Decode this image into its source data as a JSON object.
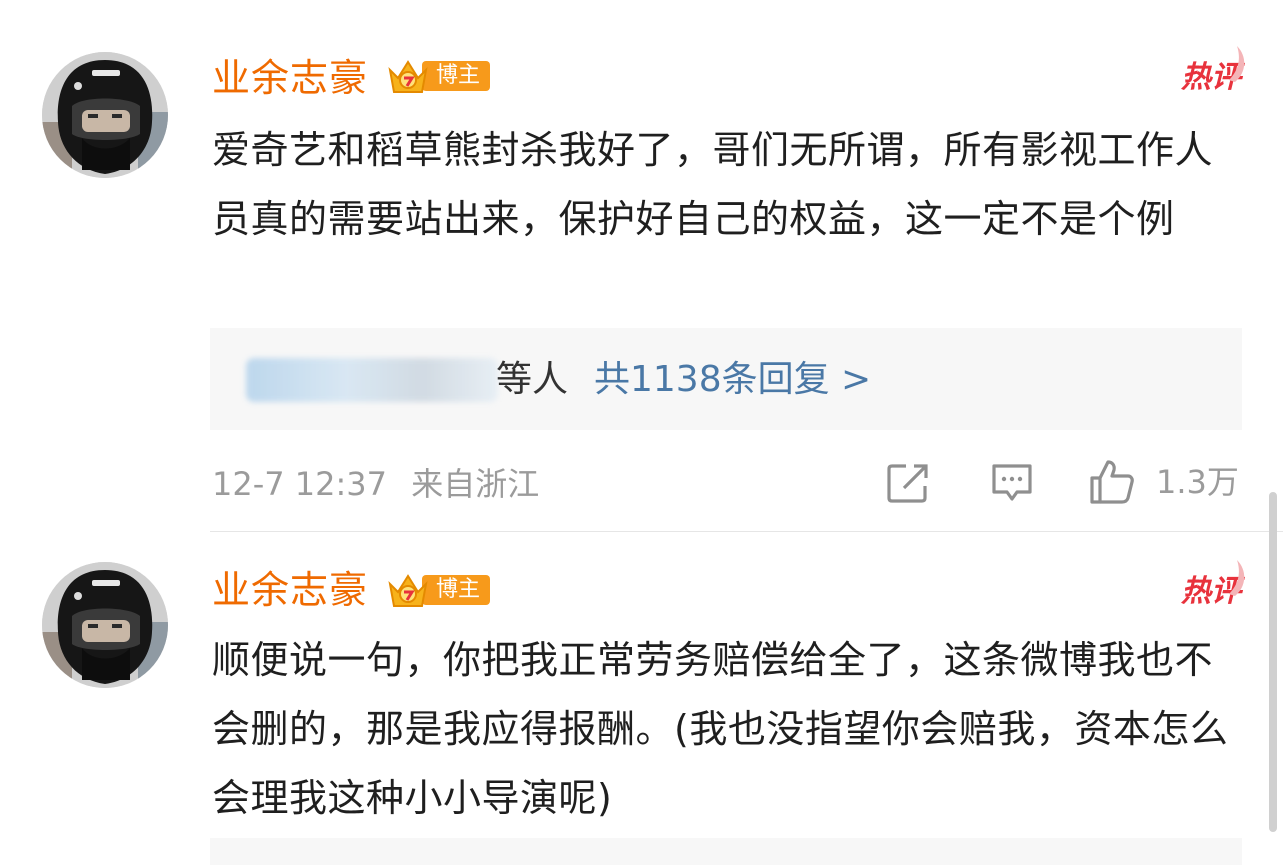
{
  "comments": [
    {
      "username": "业余志豪",
      "badge": "博主",
      "hot_label": "热评",
      "text": "爱奇艺和稻草熊封杀我好了，哥们无所谓，所有影视工作人员真的需要站出来，保护好自己的权益，这一定不是个例",
      "reply_others": "等人",
      "reply_link": "共1138条回复 >",
      "timestamp": "12-7 12:37",
      "location": "来自浙江",
      "like_count": "1.3万"
    },
    {
      "username": "业余志豪",
      "badge": "博主",
      "hot_label": "热评",
      "text": "顺便说一句，你把我正常劳务赔偿给全了，这条微博我也不会删的，那是我应得报酬。(我也没指望你会赔我，资本怎么会理我这种小小导演呢)"
    }
  ],
  "icons": {
    "share": "share-icon",
    "comment": "comment-icon",
    "like": "thumbs-up-icon",
    "crown": "crown-icon",
    "hot": "hot-comment-icon"
  },
  "colors": {
    "username": "#ef6a00",
    "badge": "#f79a1b",
    "hot": "#e8323c",
    "reply_link": "#4a78a6",
    "meta": "#9b9b9b",
    "reply_bg": "#f7f7f7"
  }
}
